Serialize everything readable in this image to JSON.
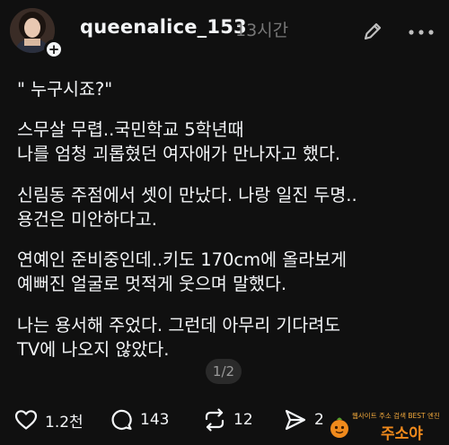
{
  "post": {
    "username": "queenalice_153",
    "time": "13시간",
    "lines": [
      "\" 누구시죠?\"",
      "스무살 무렵..국민학교 5학년때",
      "나를 엄청 괴롭혔던 여자애가 만나자고 했다.",
      "신림동 주점에서 셋이 만났다. 나랑 일진 두명..",
      "용건은 미안하다고.",
      "연예인 준비중인데..키도 170cm에 올라보게",
      "예뻐진 얼굴로 멋적게 웃으며 말했다.",
      "나는 용서해 주었다. 그런데 아무리 기다려도",
      "TV에 나오지 않았다."
    ],
    "page_indicator": "1/2"
  },
  "avatar": {
    "plus": "+"
  },
  "actions": {
    "like_count": "1.2천",
    "comment_count": "143",
    "repost_count": "12",
    "share_count": "2"
  },
  "watermark": {
    "line1": "웹사이트 주소 검색 BEST 엔진",
    "line2": "주소야"
  },
  "icons": {
    "edit": "edit-pencil-icon",
    "more": "more-horizontal-icon",
    "like": "heart-icon",
    "comment": "comment-bubble-icon",
    "repost": "repost-icon",
    "share": "send-icon"
  },
  "colors": {
    "background": "#101010",
    "text": "#f3f5f7",
    "muted": "#777777",
    "watermark": "#f08a1c"
  }
}
